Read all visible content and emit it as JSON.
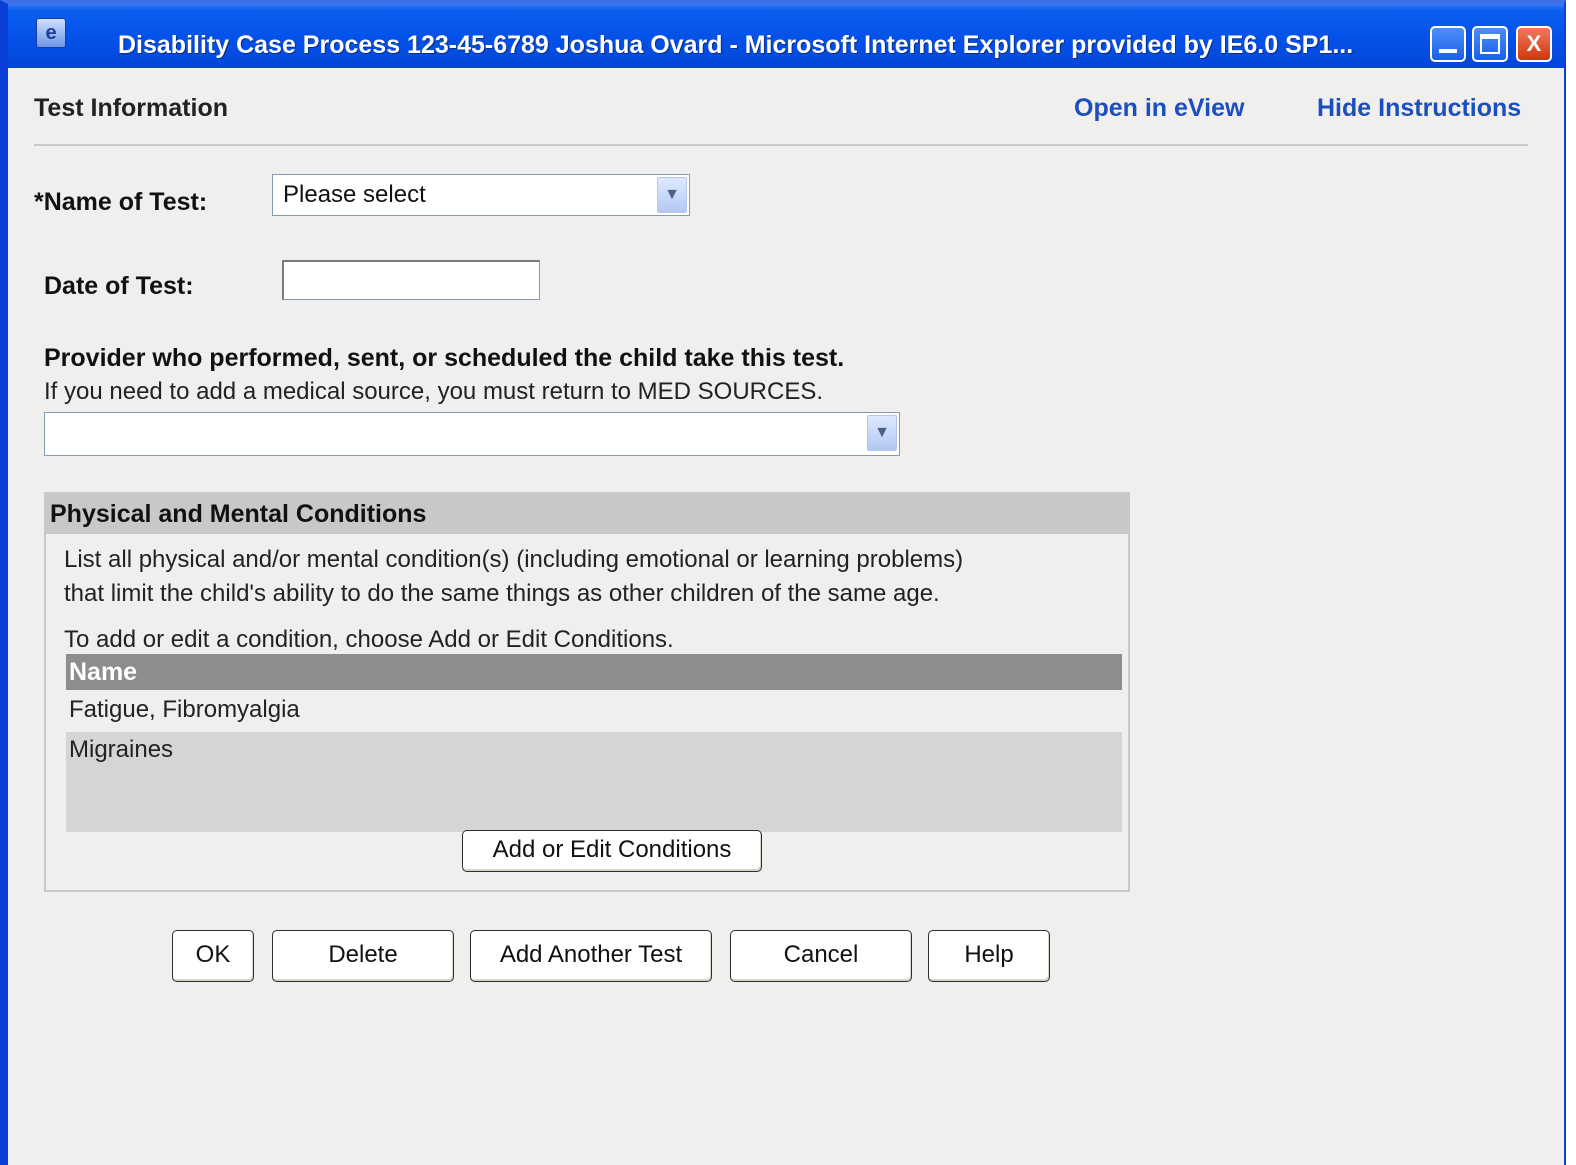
{
  "window": {
    "title": "Disability Case Process 123-45-6789 Joshua Ovard  -  Microsoft Internet Explorer provided by IE6.0 SP1...",
    "close_glyph": "X"
  },
  "header": {
    "title": "Test Information",
    "open_link": "Open in eView",
    "hide_link": "Hide Instructions"
  },
  "form": {
    "name_label": "*Name of Test:",
    "name_value": "Please select",
    "date_label": "Date of Test:",
    "date_value": "",
    "provider_label": "Provider who performed, sent, or scheduled the child take this test.",
    "provider_hint": "If you need to add a medical source, you must return to MED SOURCES.",
    "provider_value": ""
  },
  "conditions": {
    "heading": "Physical and Mental Conditions",
    "desc_line1": "List all physical and/or mental condition(s) (including emotional or learning problems)",
    "desc_line2": "that limit the child's ability to do the same things as other children of the same age.",
    "instruction": "To add or edit a condition, choose Add or Edit Conditions.",
    "column_header": "Name",
    "rows": [
      "Fatigue, Fibromyalgia",
      "Migraines"
    ],
    "edit_button": "Add or Edit Conditions"
  },
  "buttons": {
    "ok": "OK",
    "delete": "Delete",
    "add_another": "Add Another Test",
    "cancel": "Cancel",
    "help": "Help"
  }
}
